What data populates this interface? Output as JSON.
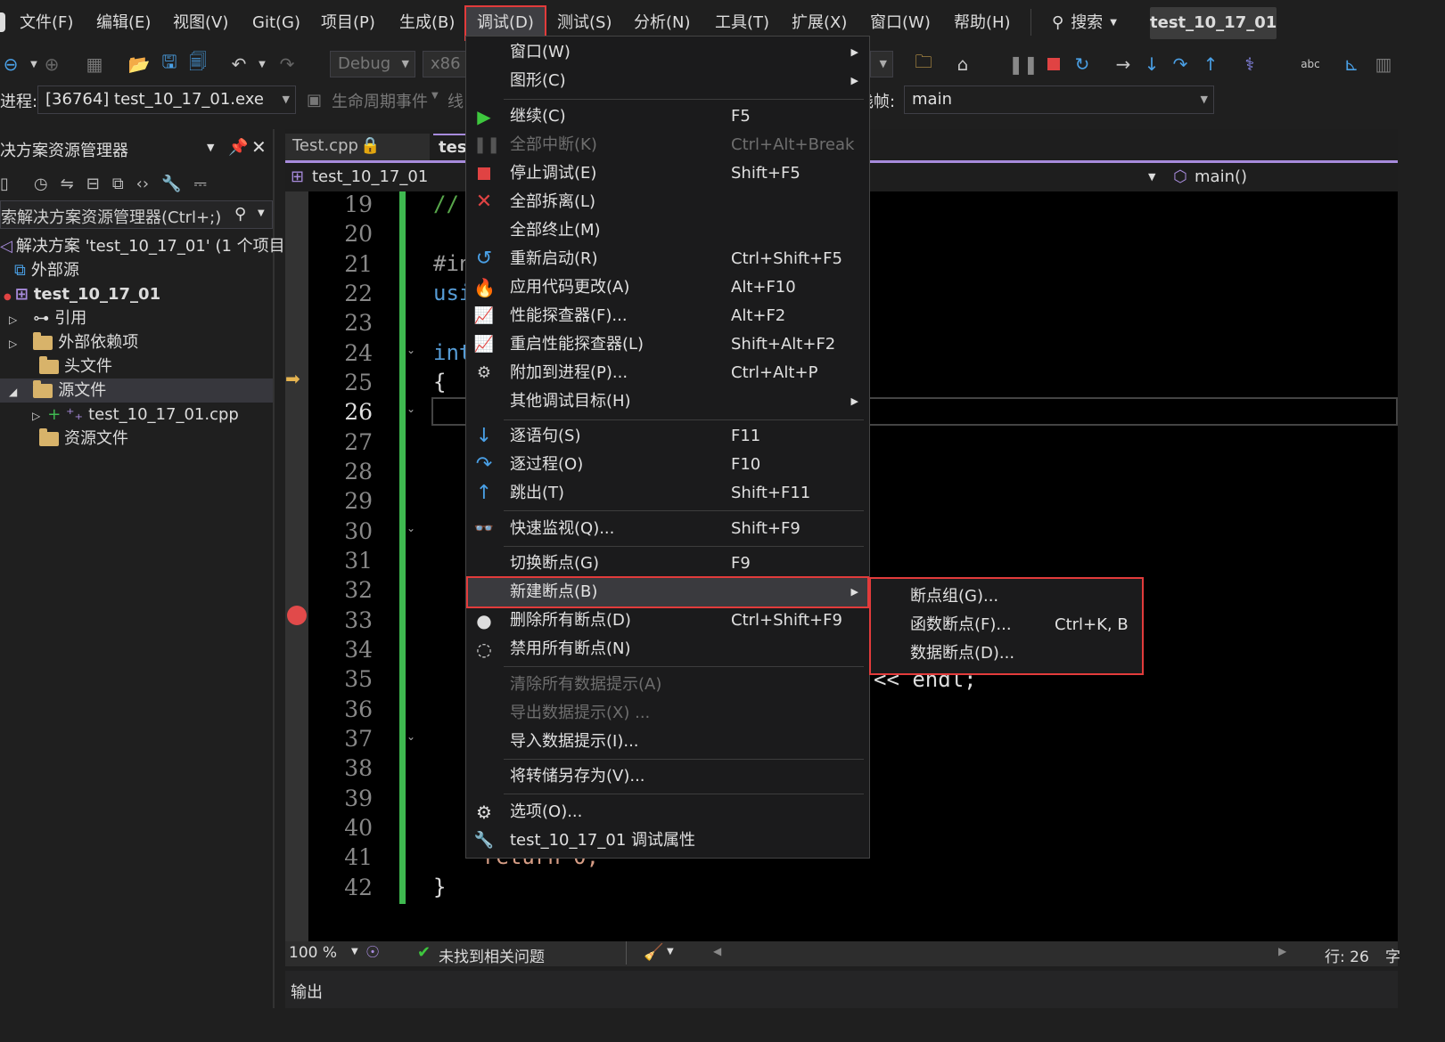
{
  "menubar": {
    "items": [
      "文件(F)",
      "编辑(E)",
      "视图(V)",
      "Git(G)",
      "项目(P)",
      "生成(B)",
      "调试(D)",
      "测试(S)",
      "分析(N)",
      "工具(T)",
      "扩展(X)",
      "窗口(W)",
      "帮助(H)"
    ],
    "search": "搜索",
    "project": "test_10_17_01"
  },
  "toolbar": {
    "config": "Debug",
    "platform": "x86"
  },
  "row3": {
    "process_label": "进程:",
    "process_value": "[36764] test_10_17_01.exe",
    "lifecycle": "生命周期事件",
    "thread_prefix": "线",
    "stack_label": "栈帧:",
    "stack_value": "main"
  },
  "solution": {
    "title": "决方案资源管理器",
    "search_placeholder": "索解决方案资源管理器(Ctrl+;)",
    "items": [
      "解决方案 'test_10_17_01' (1 个项目,",
      "外部源",
      "test_10_17_01",
      "引用",
      "外部依赖项",
      "头文件",
      "源文件",
      "test_10_17_01.cpp",
      "资源文件"
    ]
  },
  "editor": {
    "tabs": [
      "Test.cpp",
      "test"
    ],
    "nav_left": "test_10_17_01",
    "nav_right": "main()",
    "line_numbers": [
      "19",
      "20",
      "21",
      "22",
      "23",
      "24",
      "25",
      "26",
      "27",
      "28",
      "29",
      "30",
      "31",
      "32",
      "33",
      "34",
      "35",
      "36",
      "37",
      "38",
      "39",
      "40",
      "41",
      "42"
    ],
    "code": {
      "l19": "//",
      "l21": "#in",
      "l22": "usi",
      "l24": "int",
      "l25": "{",
      "l35": "<< endl;",
      "l41": "return 0;",
      "l42": "}"
    }
  },
  "debug_menu": {
    "items": [
      {
        "label": "窗口(W)",
        "shortcut": ""
      },
      {
        "label": "图形(C)",
        "shortcut": ""
      },
      {
        "label": "继续(C)",
        "shortcut": "F5"
      },
      {
        "label": "全部中断(K)",
        "shortcut": "Ctrl+Alt+Break"
      },
      {
        "label": "停止调试(E)",
        "shortcut": "Shift+F5"
      },
      {
        "label": "全部拆离(L)",
        "shortcut": ""
      },
      {
        "label": "全部终止(M)",
        "shortcut": ""
      },
      {
        "label": "重新启动(R)",
        "shortcut": "Ctrl+Shift+F5"
      },
      {
        "label": "应用代码更改(A)",
        "shortcut": "Alt+F10"
      },
      {
        "label": "性能探查器(F)...",
        "shortcut": "Alt+F2"
      },
      {
        "label": "重启性能探查器(L)",
        "shortcut": "Shift+Alt+F2"
      },
      {
        "label": "附加到进程(P)...",
        "shortcut": "Ctrl+Alt+P"
      },
      {
        "label": "其他调试目标(H)",
        "shortcut": ""
      },
      {
        "label": "逐语句(S)",
        "shortcut": "F11"
      },
      {
        "label": "逐过程(O)",
        "shortcut": "F10"
      },
      {
        "label": "跳出(T)",
        "shortcut": "Shift+F11"
      },
      {
        "label": "快速监视(Q)...",
        "shortcut": "Shift+F9"
      },
      {
        "label": "切换断点(G)",
        "shortcut": "F9"
      },
      {
        "label": "新建断点(B)",
        "shortcut": ""
      },
      {
        "label": "删除所有断点(D)",
        "shortcut": "Ctrl+Shift+F9"
      },
      {
        "label": "禁用所有断点(N)",
        "shortcut": ""
      },
      {
        "label": "清除所有数据提示(A)",
        "shortcut": ""
      },
      {
        "label": "导出数据提示(X) ...",
        "shortcut": ""
      },
      {
        "label": "导入数据提示(I)...",
        "shortcut": ""
      },
      {
        "label": "将转储另存为(V)...",
        "shortcut": ""
      },
      {
        "label": "选项(O)...",
        "shortcut": ""
      },
      {
        "label": "test_10_17_01 调试属性",
        "shortcut": ""
      }
    ]
  },
  "submenu": {
    "items": [
      {
        "label": "断点组(G)...",
        "shortcut": ""
      },
      {
        "label": "函数断点(F)...",
        "shortcut": "Ctrl+K, B"
      },
      {
        "label": "数据断点(D)...",
        "shortcut": ""
      }
    ]
  },
  "statusbar": {
    "zoom": "100 %",
    "issues": "未找到相关问题",
    "line": "行: 26",
    "char_prefix": "字"
  },
  "output": {
    "title": "输出"
  },
  "colors": {
    "highlight_border": "#e23b3b",
    "green_play": "#3ec73e",
    "stop_red": "#e04343",
    "breakpoint": "#e14a4a",
    "change_bar": "#3fb950"
  }
}
